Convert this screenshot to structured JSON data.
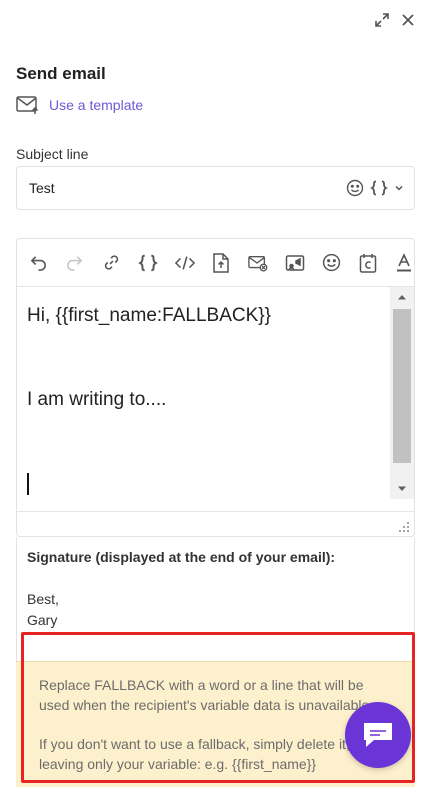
{
  "panel": {
    "title": "Send email",
    "template_link": "Use a template"
  },
  "subject": {
    "label": "Subject line",
    "value": "Test"
  },
  "editor": {
    "toolbar": [
      {
        "name": "undo-icon",
        "enabled": true
      },
      {
        "name": "redo-icon",
        "enabled": false
      },
      {
        "name": "link-icon",
        "enabled": true
      },
      {
        "name": "variables-icon",
        "enabled": true
      },
      {
        "name": "code-icon",
        "enabled": true
      },
      {
        "name": "upload-file-icon",
        "enabled": true
      },
      {
        "name": "email-cancel-icon",
        "enabled": true
      },
      {
        "name": "video-icon",
        "enabled": true
      },
      {
        "name": "emoji-icon",
        "enabled": true
      },
      {
        "name": "calendar-icon",
        "enabled": true
      },
      {
        "name": "text-color-icon",
        "enabled": true
      }
    ],
    "line1": "Hi, {{first_name:FALLBACK}}",
    "line2": "I am writing to...."
  },
  "signature": {
    "title": "Signature (displayed at the end of your email):",
    "lines": [
      "Best,",
      "Gary"
    ]
  },
  "notice": {
    "paragraph1": "Replace FALLBACK with a word or a line that will be used when the recipient's variable data is unavailable.",
    "paragraph2": "If you don't want to use a fallback, simply delete it, leaving only your variable: e.g. {{first_name}}"
  },
  "colors": {
    "accent": "#6a5bd6",
    "chat_button": "#6a34d6",
    "highlight": "#e82323",
    "notice_bg": "#fdf0cc"
  }
}
